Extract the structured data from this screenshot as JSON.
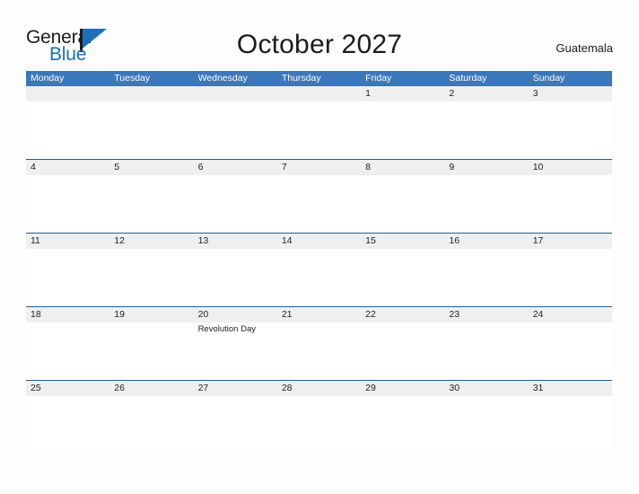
{
  "brand": {
    "name_part1": "General",
    "name_part2": "Blue",
    "flag_icon": "blue-flag-icon",
    "accent_color": "#1d6fb8"
  },
  "header": {
    "title": "October 2027",
    "country": "Guatemala"
  },
  "colors": {
    "weekday_header_bg": "#3b77ba",
    "weekday_header_text": "#ffffff",
    "date_band_bg": "#efefef",
    "row_separator": "#1f6099",
    "page_bg": "#fdfdfd",
    "body_text": "#222222"
  },
  "calendar": {
    "weekdays": [
      "Monday",
      "Tuesday",
      "Wednesday",
      "Thursday",
      "Friday",
      "Saturday",
      "Sunday"
    ],
    "weeks": [
      {
        "days": [
          {
            "date": "",
            "events": []
          },
          {
            "date": "",
            "events": []
          },
          {
            "date": "",
            "events": []
          },
          {
            "date": "",
            "events": []
          },
          {
            "date": "1",
            "events": []
          },
          {
            "date": "2",
            "events": []
          },
          {
            "date": "3",
            "events": []
          }
        ]
      },
      {
        "days": [
          {
            "date": "4",
            "events": []
          },
          {
            "date": "5",
            "events": []
          },
          {
            "date": "6",
            "events": []
          },
          {
            "date": "7",
            "events": []
          },
          {
            "date": "8",
            "events": []
          },
          {
            "date": "9",
            "events": []
          },
          {
            "date": "10",
            "events": []
          }
        ]
      },
      {
        "days": [
          {
            "date": "11",
            "events": []
          },
          {
            "date": "12",
            "events": []
          },
          {
            "date": "13",
            "events": []
          },
          {
            "date": "14",
            "events": []
          },
          {
            "date": "15",
            "events": []
          },
          {
            "date": "16",
            "events": []
          },
          {
            "date": "17",
            "events": []
          }
        ]
      },
      {
        "days": [
          {
            "date": "18",
            "events": []
          },
          {
            "date": "19",
            "events": []
          },
          {
            "date": "20",
            "events": [
              "Revolution Day"
            ]
          },
          {
            "date": "21",
            "events": []
          },
          {
            "date": "22",
            "events": []
          },
          {
            "date": "23",
            "events": []
          },
          {
            "date": "24",
            "events": []
          }
        ]
      },
      {
        "days": [
          {
            "date": "25",
            "events": []
          },
          {
            "date": "26",
            "events": []
          },
          {
            "date": "27",
            "events": []
          },
          {
            "date": "28",
            "events": []
          },
          {
            "date": "29",
            "events": []
          },
          {
            "date": "30",
            "events": []
          },
          {
            "date": "31",
            "events": []
          }
        ]
      }
    ]
  }
}
